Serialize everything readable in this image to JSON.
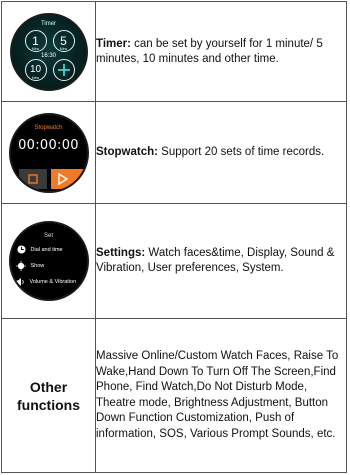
{
  "rows": [
    {
      "title": "Timer:",
      "text": " can be set by yourself for 1 minute/ 5 minutes, 10 minutes and other time.",
      "watch": {
        "header": "Timer",
        "time": "16:30",
        "presets": [
          {
            "value": "1",
            "unit": "Mins"
          },
          {
            "value": "5",
            "unit": "Mins"
          },
          {
            "value": "10",
            "unit": "Mins"
          }
        ],
        "add_icon": "plus-icon"
      }
    },
    {
      "title": "Stopwatch:",
      "text": " Support 20 sets of time records.",
      "watch": {
        "header": "Stopwatch",
        "display": "00:00:00",
        "buttons": [
          "stop-icon",
          "play-icon"
        ],
        "accent": "#f07a28"
      }
    },
    {
      "title": "Settings:",
      "text": " Watch faces&time, Display, Sound & Vibration, User preferences, System.",
      "watch": {
        "header": "Set",
        "items": [
          {
            "label": "Dial and time",
            "icon": "clock-icon"
          },
          {
            "label": "Show",
            "icon": "sun-icon"
          },
          {
            "label": "Volume & Vibration",
            "icon": "speaker-icon"
          }
        ]
      }
    },
    {
      "label": "Other functions",
      "text": "Massive Online/Custom Watch Faces, Raise To Wake,Hand Down To Turn Off The Screen,Find Phone, Find Watch,Do Not Disturb Mode, Theatre mode, Brightness Adjustment, Button Down Function Customization, Push of information, SOS, Various Prompt Sounds, etc."
    }
  ]
}
